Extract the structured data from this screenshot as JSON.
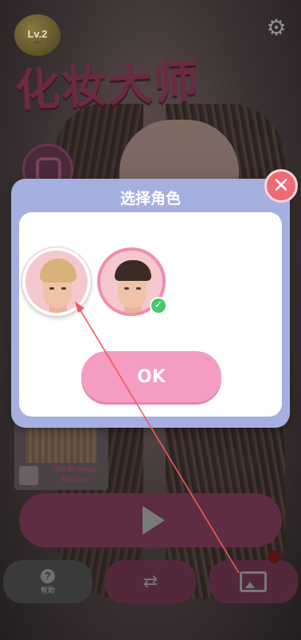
{
  "background": {
    "level_badge": {
      "level": "Lv.2",
      "sub": ""
    },
    "settings_icon": "gear-icon",
    "logo_text": "化妆大师",
    "pet_card": {
      "label": "Pet Makeup Master"
    },
    "play_icon": "play-icon",
    "bottom_buttons": {
      "help_label": "帮助",
      "help_icon": "question-icon",
      "swap_icon": "swap-icon",
      "gallery_icon": "photo-icon"
    }
  },
  "dialog": {
    "title": "选择角色",
    "close_icon": "close-icon",
    "characters": [
      {
        "name": "blond-male-character",
        "selected": false
      },
      {
        "name": "dark-hair-male-character",
        "selected": true
      }
    ],
    "check_glyph": "✓",
    "ok_label": "OK"
  },
  "colors": {
    "dialog_header": "#a5b0e0",
    "ok_button": "#f59cc2",
    "close_button": "#ef6b74",
    "check": "#45c96b"
  }
}
